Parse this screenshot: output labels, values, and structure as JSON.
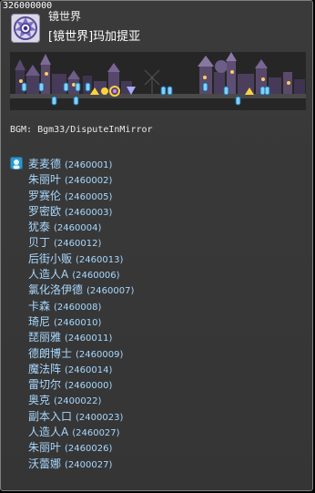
{
  "map": {
    "id": "326000000",
    "group": "镜世界",
    "name": "[镜世界]玛加提亚",
    "bgm": "BGM: Bgm33/DisputeInMirror"
  },
  "icons": {
    "map_icon": "eye-portal-icon",
    "npc_icon": "npc-icon"
  },
  "npcs": [
    {
      "name": "麦麦德",
      "id": "(2460001)"
    },
    {
      "name": "朱丽叶",
      "id": "(2460002)"
    },
    {
      "name": "罗赛伦",
      "id": "(2460005)"
    },
    {
      "name": "罗密欧",
      "id": "(2460003)"
    },
    {
      "name": "犹泰",
      "id": "(2460004)"
    },
    {
      "name": "贝丁",
      "id": "(2460012)"
    },
    {
      "name": "后街小贩",
      "id": "(2460013)"
    },
    {
      "name": "人造人A",
      "id": "(2460006)"
    },
    {
      "name": "氯化洛伊德",
      "id": "(2460007)"
    },
    {
      "name": "卡森",
      "id": "(2460008)"
    },
    {
      "name": "琦尼",
      "id": "(2460010)"
    },
    {
      "name": "琵丽雅",
      "id": "(2460011)"
    },
    {
      "name": "德朗博士",
      "id": "(2460009)"
    },
    {
      "name": "魔法阵",
      "id": "(2460014)"
    },
    {
      "name": "雷切尔",
      "id": "(2460000)"
    },
    {
      "name": "奥克",
      "id": "(2400022)"
    },
    {
      "name": "副本入口",
      "id": "(2400023)"
    },
    {
      "name": "人造人A",
      "id": "(2460027)"
    },
    {
      "name": "朱丽叶",
      "id": "(2460026)"
    },
    {
      "name": "沃蕾娜",
      "id": "(2400027)"
    }
  ]
}
